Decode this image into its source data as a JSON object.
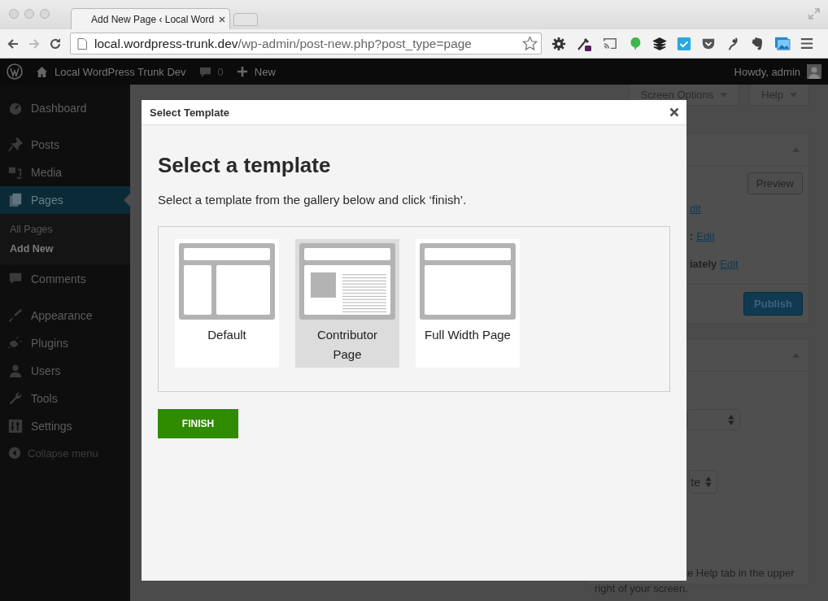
{
  "browser": {
    "tab_title": "Add New Page ‹ Local Word",
    "url_host": "local.wordpress-trunk.dev",
    "url_path": "/wp-admin/post-new.php?post_type=page",
    "forward_disabled": true
  },
  "admin_bar": {
    "site": "Local WordPress Trunk Dev",
    "comments": "0",
    "new": "New",
    "greeting": "Howdy, admin"
  },
  "sidebar": {
    "groups": [
      [
        {
          "label": "Dashboard",
          "selected": false
        }
      ],
      [
        {
          "label": "Posts",
          "selected": false
        },
        {
          "label": "Media",
          "selected": false
        },
        {
          "label": "Pages",
          "selected": true,
          "children": [
            {
              "label": "All Pages",
              "selected": false
            },
            {
              "label": "Add New",
              "selected": true
            }
          ]
        },
        {
          "label": "Comments",
          "selected": false
        }
      ],
      [
        {
          "label": "Appearance",
          "selected": false
        },
        {
          "label": "Plugins",
          "selected": false
        },
        {
          "label": "Users",
          "selected": false
        },
        {
          "label": "Tools",
          "selected": false
        },
        {
          "label": "Settings",
          "selected": false
        }
      ]
    ],
    "collapse": "Collapse menu"
  },
  "screen_meta": [
    "Screen Options",
    "Help"
  ],
  "publish_box": {
    "preview": "Preview",
    "lines": [
      {
        "link": "dit"
      },
      {
        "label": ":",
        "link": "Edit"
      },
      {
        "label": "iately",
        "link": "Edit"
      }
    ],
    "publish": "Publish"
  },
  "attributes_box": {
    "selects": [
      {
        "kind": "dropdown"
      },
      {
        "kind": "dropdown",
        "value": "te"
      }
    ],
    "help": "e Help tab in the upper right of your screen."
  },
  "modal": {
    "title": "Select Template",
    "heading": "Select a template",
    "description": "Select a template from the gallery below and click ‘finish’.",
    "templates": [
      {
        "name": "Default",
        "kind": "sidebar",
        "selected": false
      },
      {
        "name": "Contributor Page",
        "kind": "image-text",
        "selected": true
      },
      {
        "name": "Full Width Page",
        "kind": "full",
        "selected": false
      }
    ],
    "finish": "FINISH"
  }
}
